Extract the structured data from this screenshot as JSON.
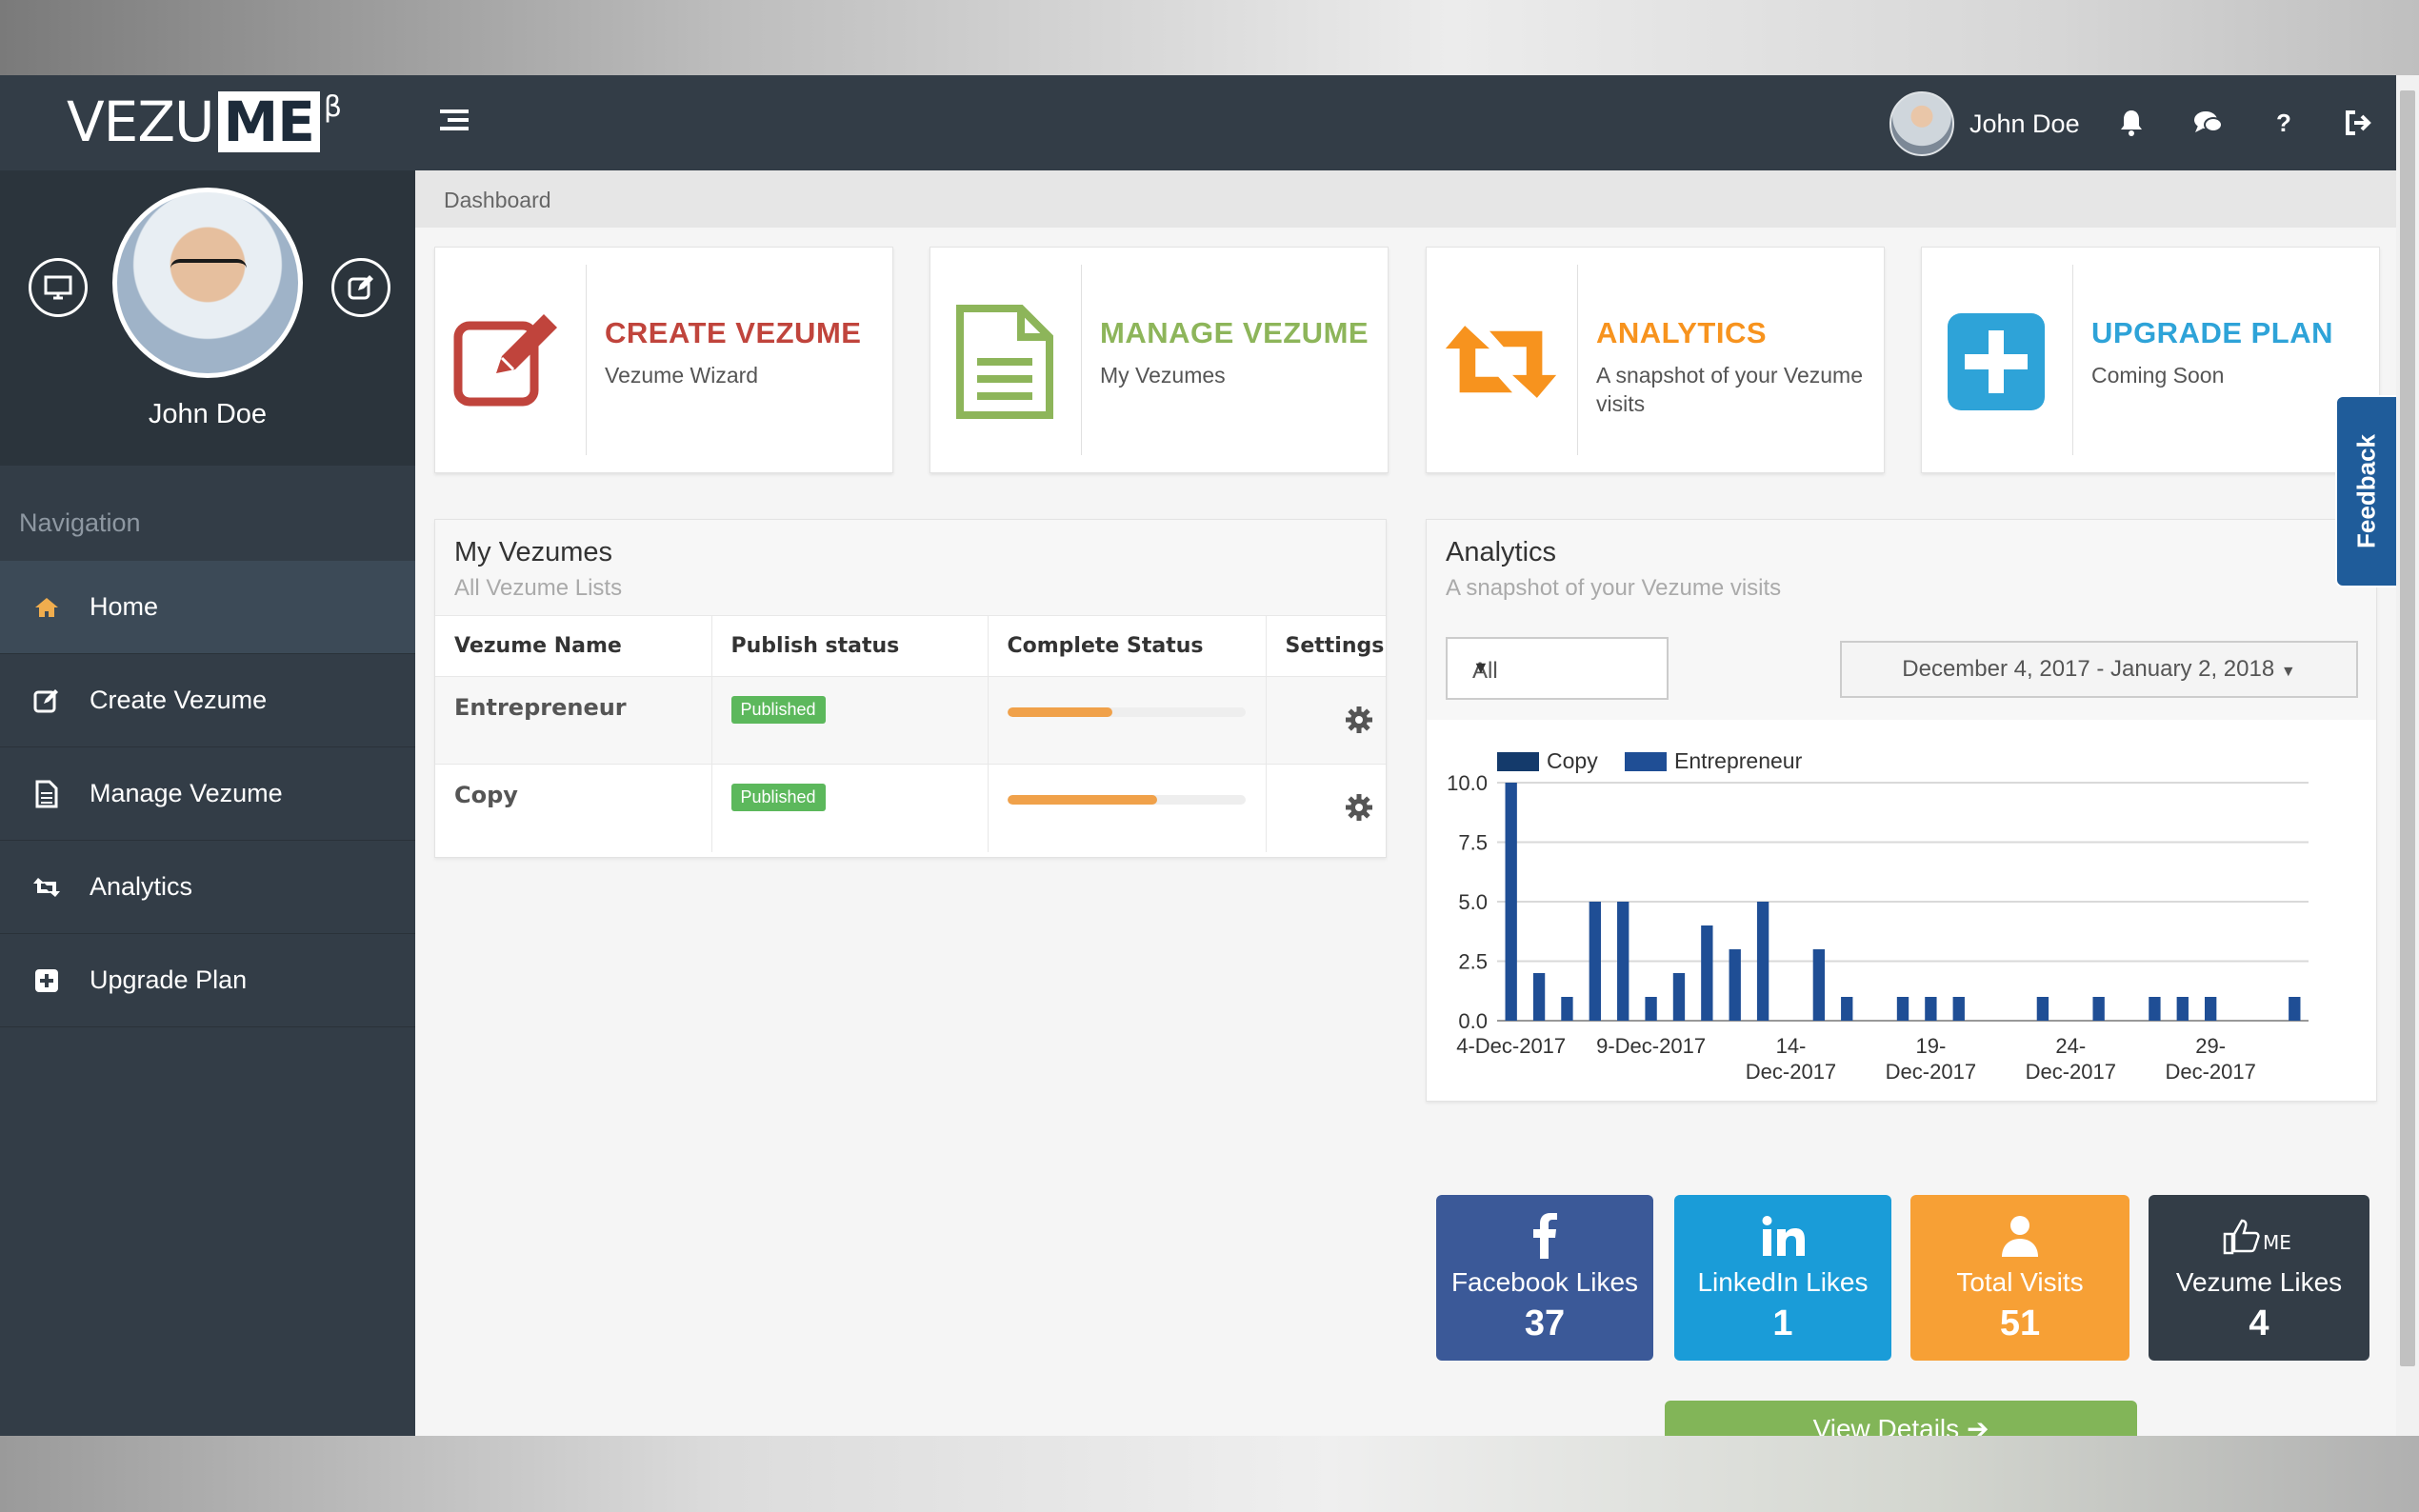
{
  "brand": {
    "logo_main": "VEZU",
    "logo_me": "ME",
    "logo_beta": "β"
  },
  "topbar": {
    "user_name": "John Doe"
  },
  "sidebar": {
    "profile_name": "John Doe",
    "nav_title": "Navigation",
    "items": [
      {
        "label": "Home"
      },
      {
        "label": "Create Vezume"
      },
      {
        "label": "Manage Vezume"
      },
      {
        "label": "Analytics"
      },
      {
        "label": "Upgrade Plan"
      }
    ]
  },
  "breadcrumb": "Dashboard",
  "cards": [
    {
      "title": "CREATE VEZUME",
      "subtitle": "Vezume Wizard",
      "color": "#c0443c"
    },
    {
      "title": "MANAGE VEZUME",
      "subtitle": "My Vezumes",
      "color": "#8db55a"
    },
    {
      "title": "ANALYTICS",
      "subtitle": "A snapshot of your Vezume visits",
      "color": "#f7931e"
    },
    {
      "title": "UPGRADE PLAN",
      "subtitle": "Coming Soon",
      "color": "#2ea3d8"
    }
  ],
  "my_vezumes": {
    "title": "My Vezumes",
    "subtitle": "All Vezume Lists",
    "columns": [
      "Vezume Name",
      "Publish status",
      "Complete Status",
      "Settings"
    ],
    "rows": [
      {
        "name": "Entrepreneur",
        "status": "Published",
        "complete": 0.44
      },
      {
        "name": "Copy",
        "status": "Published",
        "complete": 0.63
      }
    ]
  },
  "analytics": {
    "title": "Analytics",
    "subtitle": "A snapshot of your Vezume visits",
    "filter_value": "All",
    "date_range": "December 4, 2017 - January 2, 2018"
  },
  "chart_data": {
    "type": "bar",
    "x": [
      "4-Dec-2017",
      "5-Dec-2017",
      "6-Dec-2017",
      "7-Dec-2017",
      "8-Dec-2017",
      "9-Dec-2017",
      "10-Dec-2017",
      "11-Dec-2017",
      "12-Dec-2017",
      "13-Dec-2017",
      "14-Dec-2017",
      "15-Dec-2017",
      "16-Dec-2017",
      "17-Dec-2017",
      "18-Dec-2017",
      "19-Dec-2017",
      "20-Dec-2017",
      "21-Dec-2017",
      "22-Dec-2017",
      "23-Dec-2017",
      "24-Dec-2017",
      "25-Dec-2017",
      "26-Dec-2017",
      "27-Dec-2017",
      "28-Dec-2017",
      "29-Dec-2017",
      "30-Dec-2017",
      "31-Dec-2017",
      "1-Jan-2018"
    ],
    "tick_labels": [
      {
        "index": 0,
        "lines": [
          "4-Dec-2017"
        ]
      },
      {
        "index": 5,
        "lines": [
          "9-Dec-2017"
        ]
      },
      {
        "index": 10,
        "lines": [
          "14-",
          "Dec-2017"
        ]
      },
      {
        "index": 15,
        "lines": [
          "19-",
          "Dec-2017"
        ]
      },
      {
        "index": 20,
        "lines": [
          "24-",
          "Dec-2017"
        ]
      },
      {
        "index": 25,
        "lines": [
          "29-",
          "Dec-2017"
        ]
      }
    ],
    "series": [
      {
        "name": "Copy",
        "color": "#143a6b",
        "values": [
          0,
          0,
          0,
          0,
          0,
          0,
          0,
          0,
          0,
          0,
          0,
          0,
          0,
          0,
          0,
          0,
          0,
          0,
          0,
          0,
          0,
          0,
          0,
          0,
          0,
          0,
          0,
          0,
          0
        ]
      },
      {
        "name": "Entrepreneur",
        "color": "#1f4e95",
        "values": [
          10,
          2,
          1,
          5,
          5,
          1,
          2,
          4,
          3,
          5,
          0,
          3,
          1,
          0,
          1,
          1,
          1,
          0,
          0,
          1,
          0,
          1,
          0,
          1,
          1,
          1,
          0,
          0,
          1
        ]
      }
    ],
    "ylim": [
      0,
      10
    ],
    "yticks": [
      "0.0",
      "2.5",
      "5.0",
      "7.5",
      "10.0"
    ],
    "grid": true,
    "legend": "top-left"
  },
  "stats": [
    {
      "label": "Facebook Likes",
      "value": "37",
      "color": "#3b5998"
    },
    {
      "label": "LinkedIn Likes",
      "value": "1",
      "color": "#1a9cd8"
    },
    {
      "label": "Total Visits",
      "value": "51",
      "color": "#f7a035"
    },
    {
      "label": "Vezume Likes",
      "value": "4",
      "color": "#333d47"
    }
  ],
  "view_details": "View Details",
  "feedback": "Feedback"
}
